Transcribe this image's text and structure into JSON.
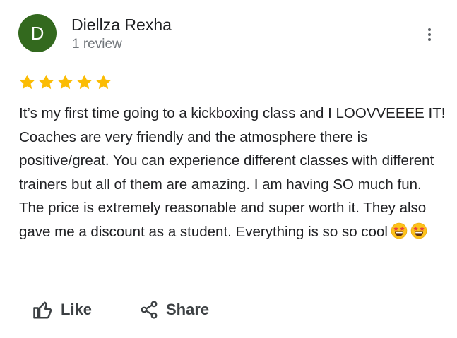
{
  "reviewer": {
    "initial": "D",
    "name": "Diellza Rexha",
    "review_count": "1 review",
    "avatar_color": "#33691e"
  },
  "rating": {
    "value": 5,
    "max": 5,
    "star_color": "#fbbc04"
  },
  "review": {
    "text": "It’s my first time going to a kickboxing class and I LOOVVEEEE IT! Coaches are very friendly and the atmosphere there is positive/great. You can experience different classes with different trainers but all of them are amazing. I am having SO much fun. The price is extremely reasonable and super worth it. They also gave me a discount as a student. Everything is so so cool",
    "emojis": [
      "star-struck-emoji",
      "star-struck-emoji"
    ]
  },
  "actions": {
    "like_label": "Like",
    "share_label": "Share",
    "like_icon": "thumb-up-icon",
    "share_icon": "share-icon",
    "more_icon": "more-vert-icon"
  }
}
